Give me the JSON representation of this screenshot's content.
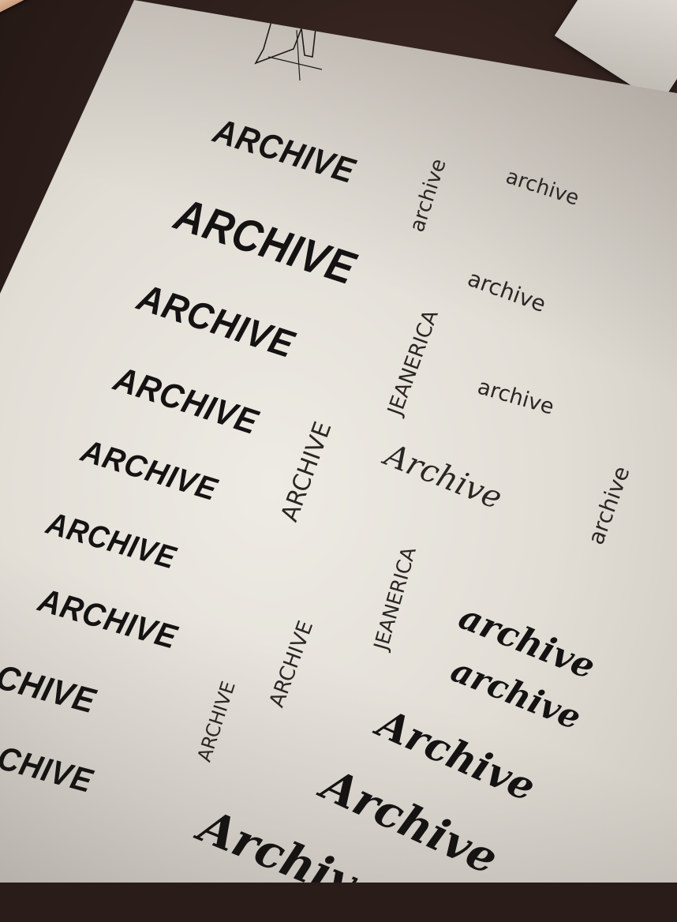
{
  "words": {
    "w1": "ARCHIVE",
    "w2": "ARCHIVE",
    "w3": "ARCHIVE",
    "w4": "ARCHIVE",
    "w5": "ARCHIVE",
    "w6": "ARCHIVE",
    "w7": "ARCHIVE",
    "w8": "CHIVE",
    "w9": "CHIVE",
    "v1": "archive",
    "v2": "archive",
    "v3": "archive",
    "v4": "archive",
    "v5": "ARCHIVE",
    "v6": "Archive",
    "v7": "archive",
    "j1": "JEANERICA",
    "j2": "JEANERICA",
    "v8": "ARCHIVE",
    "v9": "ARCHIVE",
    "s1": "archive",
    "s2": "archive",
    "s3": "Archive",
    "s4": "Archive",
    "s5": "Archive"
  },
  "colors": {
    "ink": "#141212",
    "paper": "#e6e3dc",
    "table": "#2f201c"
  },
  "icons": {
    "sketch": "jeans-sketch"
  }
}
